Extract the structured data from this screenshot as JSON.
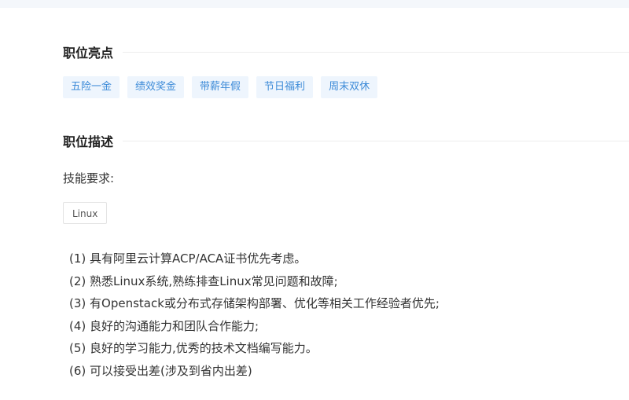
{
  "highlights": {
    "title": "职位亮点",
    "tags": [
      "五险一金",
      "绩效奖金",
      "带薪年假",
      "节日福利",
      "周末双休"
    ]
  },
  "description": {
    "title": "职位描述",
    "skills_label": "技能要求:",
    "skill_tags": [
      "Linux"
    ],
    "items": [
      "(1) 具有阿里云计算ACP/ACA证书优先考虑。",
      "(2) 熟悉Linux系统,熟练排查Linux常见问题和故障;",
      "(3) 有Openstack或分布式存储架构部署、优化等相关工作经验者优先;",
      "(4) 良好的沟通能力和团队合作能力;",
      "(5) 良好的学习能力,优秀的技术文档编写能力。",
      "(6) 可以接受出差(涉及到省内出差)"
    ]
  }
}
